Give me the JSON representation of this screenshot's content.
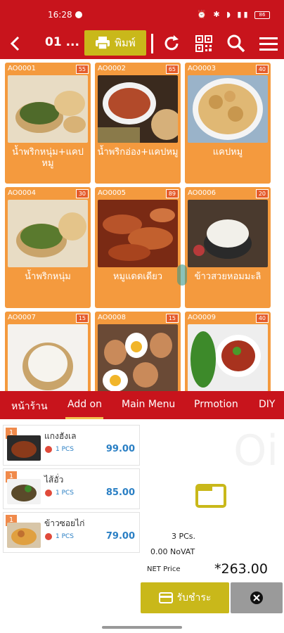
{
  "status": {
    "time": "16:28",
    "battery": "86"
  },
  "toolbar": {
    "table_label": "01 ...",
    "print_label": "พิมพ์"
  },
  "menu_items": [
    {
      "code": "AO0001",
      "badge": "55",
      "name": "น้ำพริกหนุ่ม+แคปหมู",
      "photo": "chili-dip-pork-rind"
    },
    {
      "code": "AO0002",
      "badge": "65",
      "name": "น้ำพริกอ่อง+แคปหมู",
      "photo": "red-chili-dip"
    },
    {
      "code": "AO0003",
      "badge": "40",
      "name": "แคปหมู",
      "photo": "pork-rinds"
    },
    {
      "code": "AO0004",
      "badge": "30",
      "name": "น้ำพริกหนุ่ม",
      "photo": "green-chili-dip"
    },
    {
      "code": "AO0005",
      "badge": "89",
      "name": "หมูแดดเดียว",
      "photo": "sun-dried-pork"
    },
    {
      "code": "AO0006",
      "badge": "20",
      "name": "ข้าวสวยหอมมะลิ",
      "photo": "jasmine-rice"
    },
    {
      "code": "AO0007",
      "badge": "15",
      "name": "",
      "photo": "sticky-rice"
    },
    {
      "code": "AO0008",
      "badge": "15",
      "name": "",
      "photo": "boiled-eggs"
    },
    {
      "code": "AO0009",
      "badge": "40",
      "name": "",
      "photo": "chili-dip-herbs"
    }
  ],
  "tabs": [
    {
      "label": "หน้าร้าน"
    },
    {
      "label": "Add on"
    },
    {
      "label": "Main Menu"
    },
    {
      "label": "Prmotion"
    },
    {
      "label": "DIY"
    }
  ],
  "order": {
    "items": [
      {
        "num": "1",
        "name": "แกงฮังเล",
        "qty": "1 PCS",
        "price": "99.00"
      },
      {
        "num": "1",
        "name": "ไส้อั่ว",
        "qty": "1 PCS",
        "price": "85.00"
      },
      {
        "num": "1",
        "name": "ข้าวซอยไก่",
        "qty": "1 PCS",
        "price": "79.00"
      }
    ],
    "total_pcs": "3 PCs.",
    "novat": "0.00 NoVAT",
    "net_label": "NET Price",
    "net_value": "*263.00",
    "pay_label": "รับชำระ"
  },
  "colors": {
    "primary": "#c8141c",
    "card": "#f49a3e",
    "accent": "#c9b81a"
  }
}
